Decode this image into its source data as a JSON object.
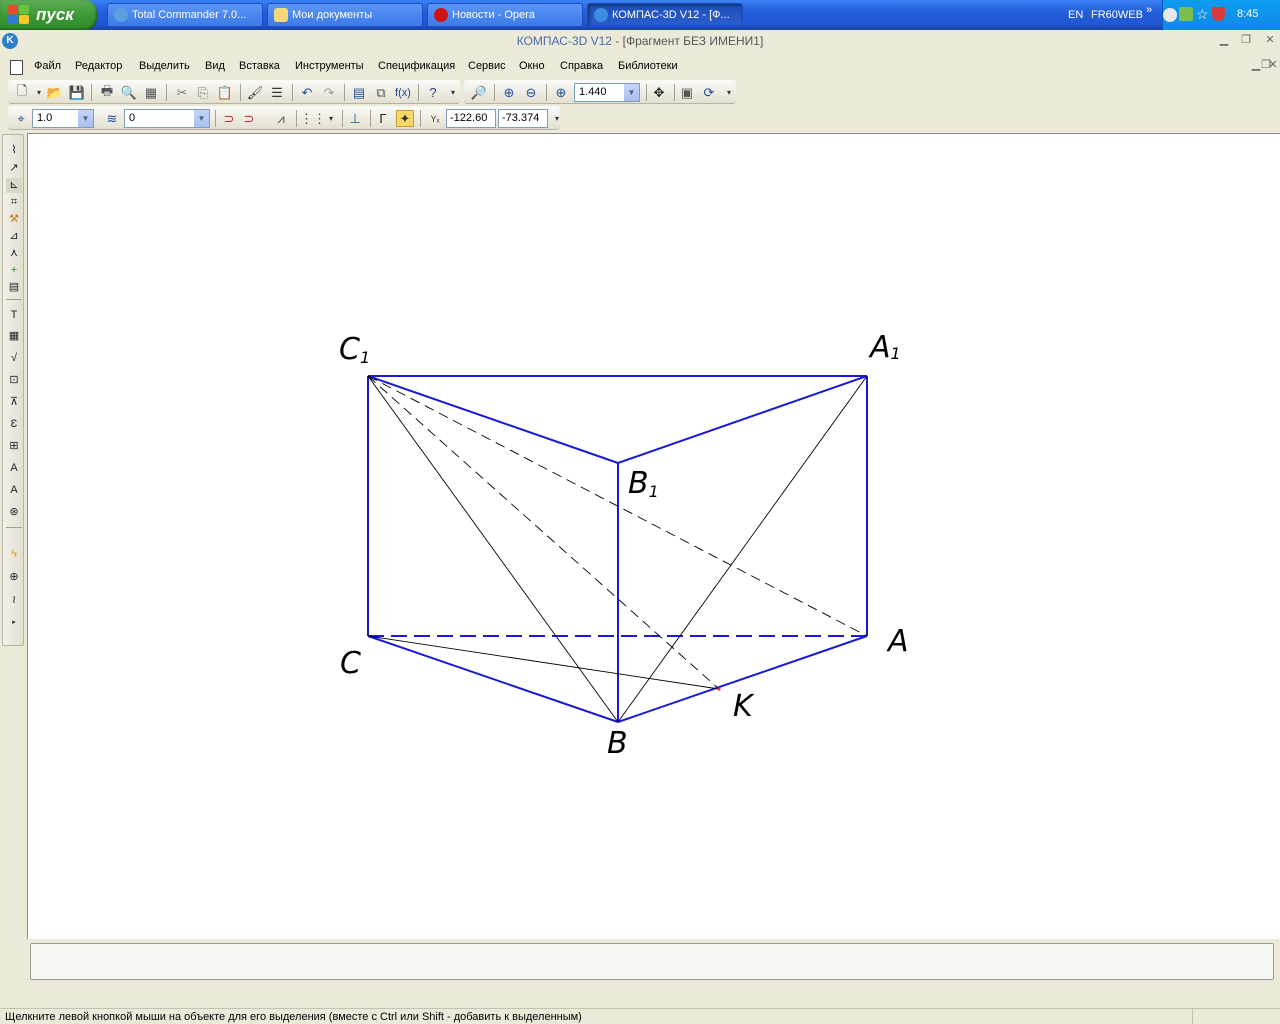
{
  "taskbar": {
    "start_label": "пуск",
    "tasks": [
      {
        "label": "Total Commander 7.0...",
        "icon": "total-commander-icon"
      },
      {
        "label": "Мои документы",
        "icon": "folder-icon"
      },
      {
        "label": "Новости - Opera",
        "icon": "opera-icon"
      },
      {
        "label": "КОМПАС-3D V12 - [Ф...",
        "icon": "kompas-icon"
      }
    ],
    "lang": "EN",
    "user": "FR60WEB",
    "clock": "8:45"
  },
  "window": {
    "app_name": "КОМПАС-3D V12",
    "sep": " - ",
    "doc_name": "[Фрагмент БЕЗ ИМЕНИ1]"
  },
  "menu": [
    "Файл",
    "Редактор",
    "Выделить",
    "Вид",
    "Вставка",
    "Инструменты",
    "Спецификация",
    "Сервис",
    "Окно",
    "Справка",
    "Библиотеки"
  ],
  "toolbar": {
    "zoom_value": "1.440",
    "style_value": "1.0",
    "layer_value": "0",
    "coord_x": "-122.60",
    "coord_y": "-73.374",
    "fx_label": "f(x)"
  },
  "drawing": {
    "labels": {
      "C1_main": "C",
      "C1_sub": "1",
      "A1_main": "A",
      "A1_sub": "1",
      "B1_main": "B",
      "B1_sub": "1",
      "A": "A",
      "B": "B",
      "C": "C",
      "K": "K"
    },
    "colors": {
      "edge": "#1a1ad6",
      "aux": "#000000"
    }
  },
  "status": {
    "hint": "Щелкните левой кнопкой мыши на объекте для его выделения (вместе с Ctrl или Shift - добавить к выделенным)"
  }
}
